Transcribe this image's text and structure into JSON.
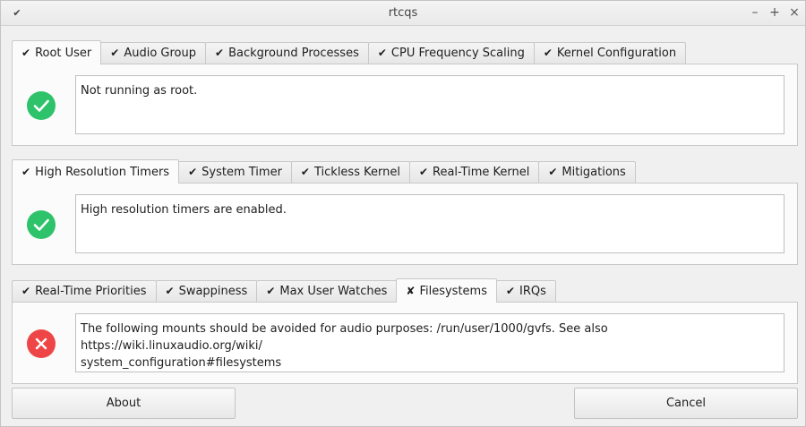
{
  "window": {
    "title": "rtcqs",
    "menu_icon": "chevron-down-icon",
    "controls": {
      "minimize": "–",
      "maximize": "+",
      "close": "×"
    }
  },
  "groups": [
    {
      "tabs": [
        {
          "mark": "✔",
          "label": "Root User",
          "active": true
        },
        {
          "mark": "✔",
          "label": "Audio Group",
          "active": false
        },
        {
          "mark": "✔",
          "label": "Background Processes",
          "active": false
        },
        {
          "mark": "✔",
          "label": "CPU Frequency Scaling",
          "active": false
        },
        {
          "mark": "✔",
          "label": "Kernel Configuration",
          "active": false
        }
      ],
      "status": "ok",
      "message": "Not running as root."
    },
    {
      "tabs": [
        {
          "mark": "✔",
          "label": "High Resolution Timers",
          "active": true
        },
        {
          "mark": "✔",
          "label": "System Timer",
          "active": false
        },
        {
          "mark": "✔",
          "label": "Tickless Kernel",
          "active": false
        },
        {
          "mark": "✔",
          "label": "Real-Time Kernel",
          "active": false
        },
        {
          "mark": "✔",
          "label": "Mitigations",
          "active": false
        }
      ],
      "status": "ok",
      "message": "High resolution timers are enabled."
    },
    {
      "tabs": [
        {
          "mark": "✔",
          "label": "Real-Time Priorities",
          "active": false
        },
        {
          "mark": "✔",
          "label": "Swappiness",
          "active": false
        },
        {
          "mark": "✔",
          "label": "Max User Watches",
          "active": false
        },
        {
          "mark": "✘",
          "label": "Filesystems",
          "active": true
        },
        {
          "mark": "✔",
          "label": "IRQs",
          "active": false
        }
      ],
      "status": "error",
      "message": "The following mounts should be avoided for audio purposes: /run/user/1000/gvfs. See also https://wiki.linuxaudio.org/wiki/\nsystem_configuration#filesystems"
    }
  ],
  "colors": {
    "ok": "#2ec26b",
    "error": "#ee4646"
  },
  "buttons": {
    "about": "About",
    "cancel": "Cancel"
  }
}
